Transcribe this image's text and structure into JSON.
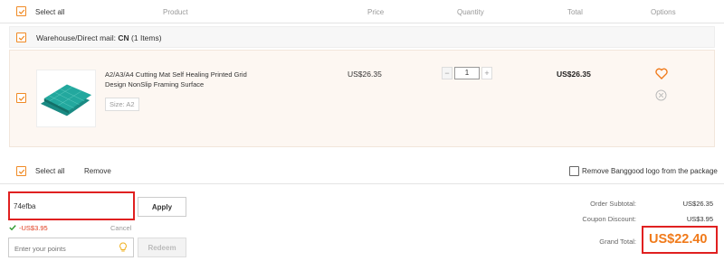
{
  "header": {
    "select_all": "Select all",
    "product": "Product",
    "price": "Price",
    "quantity": "Quantity",
    "total": "Total",
    "options": "Options"
  },
  "warehouse": {
    "prefix": "Warehouse/Direct mail: ",
    "code": "CN",
    "count": " (1 Items)"
  },
  "item": {
    "name": "A2/A3/A4 Cutting Mat Self Healing Printed Grid Design NonSlip Framing Surface",
    "attribute": "Size: A2",
    "price": "US$26.35",
    "quantity": "1",
    "minus": "−",
    "plus": "+",
    "total": "US$26.35"
  },
  "footer_row": {
    "select_all": "Select all",
    "remove": "Remove",
    "remove_logo": "Remove Banggood logo from the package"
  },
  "coupon": {
    "value": "74efba",
    "apply": "Apply",
    "discount": "-US$3.95",
    "cancel": "Cancel"
  },
  "points": {
    "placeholder": "Enter your points",
    "redeem": "Redeem"
  },
  "summary": {
    "subtotal_label": "Order Subtotal:",
    "subtotal_value": "US$26.35",
    "coupon_label": "Coupon Discount:",
    "coupon_value": "US$3.95",
    "grand_label": "Grand Total:",
    "grand_value": "US$22.40"
  },
  "colors": {
    "accent": "#f08a24",
    "highlight": "#e02020",
    "grand_total": "#f07a1a"
  }
}
